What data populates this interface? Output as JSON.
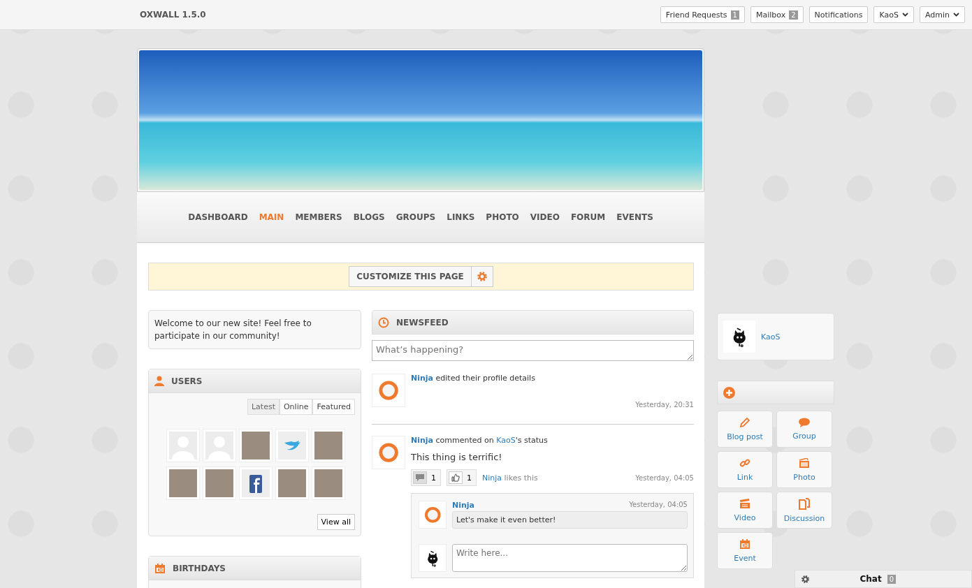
{
  "topbar": {
    "site_title": "OXWALL 1.5.0",
    "buttons": [
      {
        "kind": "count",
        "label": "Friend Requests",
        "count": "1"
      },
      {
        "kind": "count",
        "label": "Mailbox",
        "count": "2"
      },
      {
        "kind": "plain",
        "label": "Notifications"
      },
      {
        "kind": "menu",
        "label": "KaoS"
      },
      {
        "kind": "menu",
        "label": "Admin"
      }
    ]
  },
  "nav": [
    {
      "label": "DASHBOARD",
      "selected": false
    },
    {
      "label": "MAIN",
      "selected": true
    },
    {
      "label": "MEMBERS",
      "selected": false
    },
    {
      "label": "BLOGS",
      "selected": false
    },
    {
      "label": "GROUPS",
      "selected": false
    },
    {
      "label": "LINKS",
      "selected": false
    },
    {
      "label": "PHOTO",
      "selected": false
    },
    {
      "label": "VIDEO",
      "selected": false
    },
    {
      "label": "FORUM",
      "selected": false
    },
    {
      "label": "EVENTS",
      "selected": false
    }
  ],
  "customize_button": "CUSTOMIZE THIS PAGE",
  "welcome": "Welcome to our new site! Feel free to participate in our community!",
  "users": {
    "title": "USERS",
    "tabs": [
      {
        "label": "Latest",
        "selected": true
      },
      {
        "label": "Online",
        "selected": false
      },
      {
        "label": "Featured",
        "selected": false
      }
    ],
    "avatars": [
      {
        "kind": "default"
      },
      {
        "kind": "default"
      },
      {
        "kind": "photo"
      },
      {
        "kind": "bird"
      },
      {
        "kind": "photo"
      },
      {
        "kind": "photo"
      },
      {
        "kind": "photo"
      },
      {
        "kind": "letter-f"
      },
      {
        "kind": "photo"
      },
      {
        "kind": "photo"
      }
    ],
    "view_all": "View all"
  },
  "birthdays": {
    "title": "BIRTHDAYS"
  },
  "newsfeed": {
    "title": "NEWSFEED",
    "placeholder": "What’s happening?",
    "items": [
      {
        "user": "Ninja",
        "action": "edited their profile details",
        "time": "Yesterday, 20:31"
      },
      {
        "user": "Ninja",
        "action": "commented on",
        "target": "KaoS",
        "action_end": "'s status",
        "status": "This thing is terrific!",
        "comments": "1",
        "likes": "1",
        "liker": "Ninja",
        "likes_text": "likes this",
        "time": "Yesterday, 04:05",
        "replies": [
          {
            "user": "Ninja",
            "time": "Yesterday, 04:05",
            "text": "Let's make it even better!"
          }
        ],
        "reply_placeholder": "Write here..."
      }
    ]
  },
  "profile": {
    "name": "KaoS"
  },
  "quick_links": [
    {
      "kind": "pencil",
      "label": "Blog post"
    },
    {
      "kind": "bubble",
      "label": "Group"
    },
    {
      "kind": "link",
      "label": "Link"
    },
    {
      "kind": "photo",
      "label": "Photo"
    },
    {
      "kind": "clapper",
      "label": "Video"
    },
    {
      "kind": "docs",
      "label": "Discussion"
    },
    {
      "kind": "calendar",
      "label": "Event"
    }
  ],
  "chat": {
    "label": "Chat",
    "count": "0"
  }
}
